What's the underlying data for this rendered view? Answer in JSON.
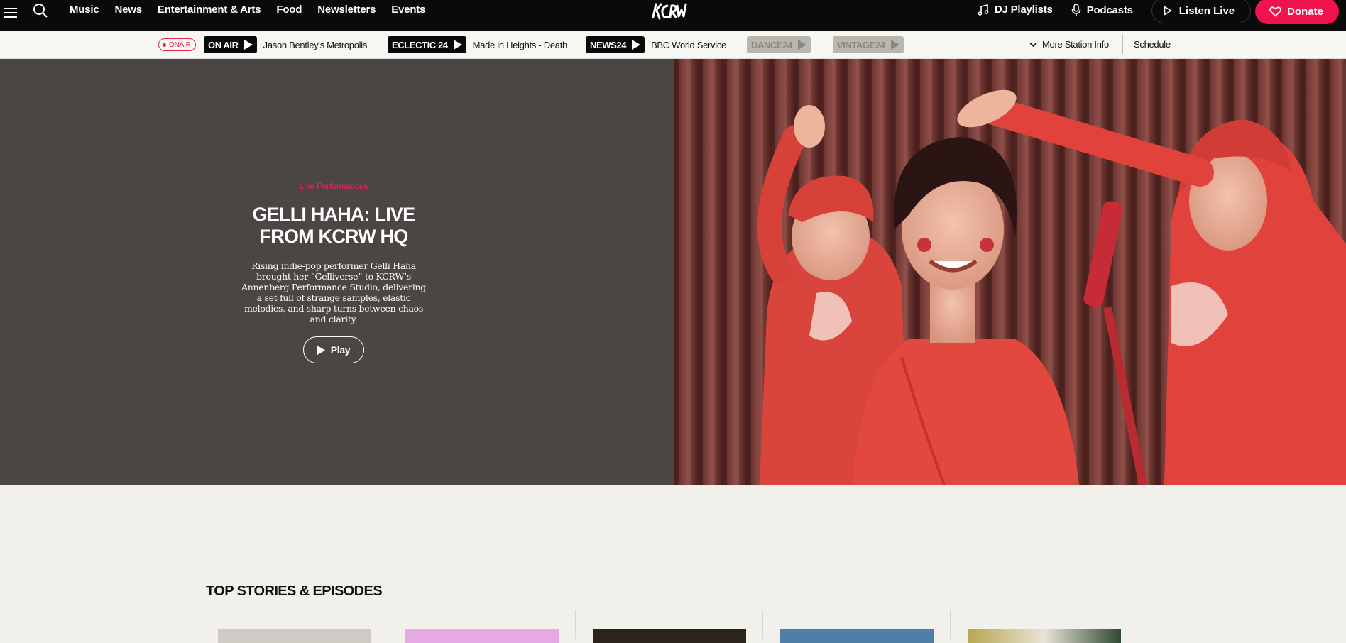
{
  "nav": {
    "links": [
      "Music",
      "News",
      "Entertainment & Arts",
      "Food",
      "Newsletters",
      "Events"
    ],
    "dj_playlists": "DJ Playlists",
    "podcasts": "Podcasts",
    "listen_live": "Listen Live",
    "donate": "Donate"
  },
  "stationbar": {
    "onair_badge": "ONAIR",
    "stations": [
      {
        "name": "ON AIR",
        "track": "Jason Bentley's Metropolis",
        "active": true
      },
      {
        "name": "ECLECTIC 24",
        "track": "Made in Heights - Death",
        "active": true
      },
      {
        "name": "NEWS24",
        "track": "BBC World Service",
        "active": true
      },
      {
        "name": "DANCE24",
        "track": "",
        "active": false
      },
      {
        "name": "VINTAGE24",
        "track": "",
        "active": false
      }
    ],
    "more_info": "More Station Info",
    "schedule": "Schedule"
  },
  "hero": {
    "category": "Live Performances",
    "title": "GELLI HAHA: LIVE FROM KCRW HQ",
    "description": "Rising indie-pop performer Gelli Haha brought her “Gelliverse” to KCRW’s Annenberg Performance Studio, delivering a set full of strange samples, elastic melodies, and sharp turns between chaos and clarity.",
    "play": "Play"
  },
  "stories": {
    "title": "TOP STORIES & EPISODES"
  },
  "colors": {
    "accent": "#f0134d",
    "nav_bg": "#0a0a0a",
    "hero_bg": "#4b4543",
    "page_bg": "#f2f0ea"
  }
}
